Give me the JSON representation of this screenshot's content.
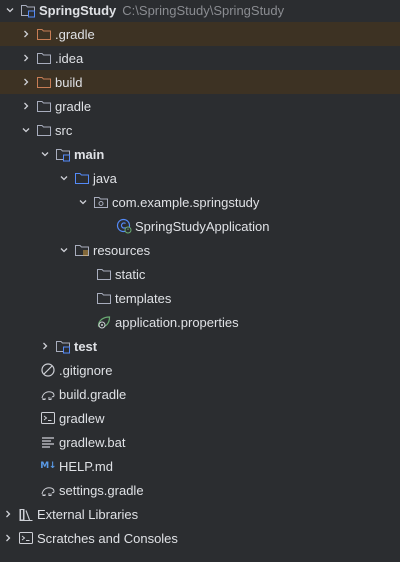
{
  "project_tree": {
    "root": {
      "name": "SpringStudy",
      "path": "C:\\SpringStudy\\SpringStudy"
    },
    "nodes": {
      "gradle_hidden": ".gradle",
      "idea": ".idea",
      "build": "build",
      "gradle": "gradle",
      "src": "src",
      "main": "main",
      "java": "java",
      "package": "com.example.springstudy",
      "app_class": "SpringStudyApplication",
      "resources": "resources",
      "static": "static",
      "templates": "templates",
      "app_properties": "application.properties",
      "test": "test",
      "gitignore": ".gitignore",
      "build_gradle": "build.gradle",
      "gradlew": "gradlew",
      "gradlew_bat": "gradlew.bat",
      "help_md": "HELP.md",
      "settings_gradle": "settings.gradle",
      "external_libraries": "External Libraries",
      "scratches": "Scratches and Consoles"
    },
    "icons": {
      "md_badge": "M↓"
    },
    "colors": {
      "background": "#2b2d30",
      "excluded_row": "#3d3223",
      "excluded_folder": "#c77d55",
      "folder": "#a8adbd",
      "source_folder": "#548af7",
      "text": "#dfe1e5",
      "path_text": "#8a8c91"
    }
  }
}
